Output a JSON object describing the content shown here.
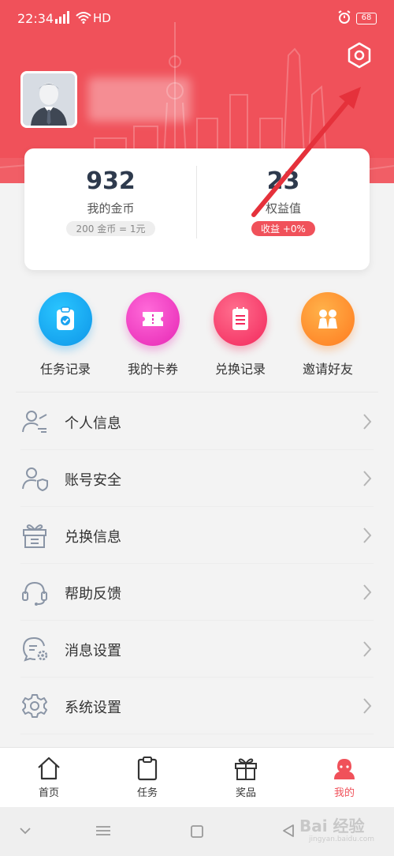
{
  "status_bar": {
    "time": "22:34",
    "network": "HD",
    "battery": "68"
  },
  "profile": {
    "username": ""
  },
  "stats": {
    "coins_value": "932",
    "coins_label": "我的金币",
    "coins_rate": "200 金币 = 1元",
    "rights_value": "23",
    "rights_label": "权益值",
    "rights_pill": "收益 +0%"
  },
  "quick_actions": [
    {
      "label": "任务记录",
      "icon": "task-record-icon"
    },
    {
      "label": "我的卡券",
      "icon": "coupon-icon"
    },
    {
      "label": "兑换记录",
      "icon": "exchange-record-icon"
    },
    {
      "label": "邀请好友",
      "icon": "invite-friends-icon"
    }
  ],
  "menu": [
    {
      "label": "个人信息",
      "icon": "person-info-icon"
    },
    {
      "label": "账号安全",
      "icon": "account-security-icon"
    },
    {
      "label": "兑换信息",
      "icon": "gift-box-icon"
    },
    {
      "label": "帮助反馈",
      "icon": "headset-icon"
    },
    {
      "label": "消息设置",
      "icon": "message-settings-icon"
    },
    {
      "label": "系统设置",
      "icon": "gear-icon"
    }
  ],
  "tabs": [
    {
      "label": "首页",
      "icon": "home-icon"
    },
    {
      "label": "任务",
      "icon": "clipboard-icon"
    },
    {
      "label": "奖品",
      "icon": "gift-icon"
    },
    {
      "label": "我的",
      "icon": "user-icon",
      "active": true
    }
  ],
  "watermark": {
    "text": "Bai 经验",
    "sub": "jingyan.baidu.com"
  },
  "colors": {
    "brand": "#f0515a",
    "text": "#333333",
    "stat_value": "#2e3a4d",
    "arrow": "#e5313b"
  }
}
